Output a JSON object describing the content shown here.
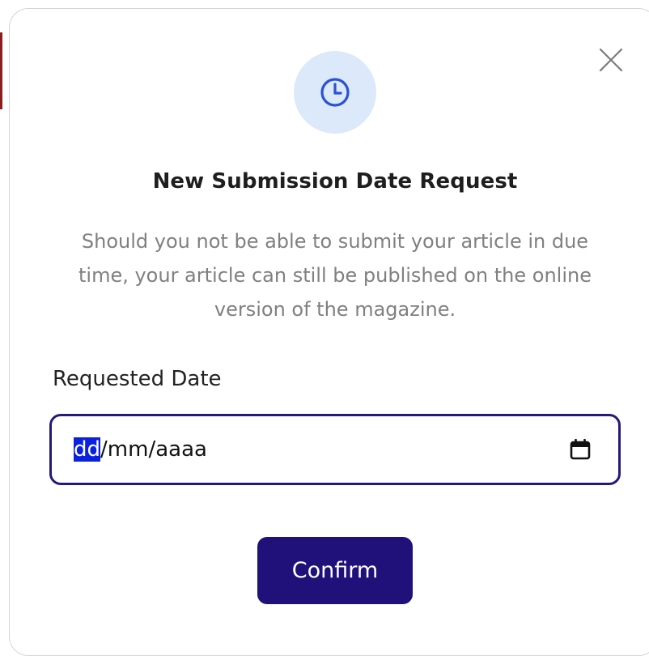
{
  "colors": {
    "accent": "#20107a",
    "icon_bg": "#dce9fb",
    "icon_fg": "#2a52d6",
    "input_border": "#241a7a",
    "selection": "#0a22e0"
  },
  "dialog": {
    "close_icon": "close-icon",
    "header_icon": "clock-icon",
    "title": "New Submission Date Request",
    "description": "Should you not be able to submit your article in due time, your article can still be published on the online version of the magazine."
  },
  "form": {
    "field_label": "Requested Date",
    "date_input": {
      "placeholder_day": "dd",
      "separator_1": "/",
      "placeholder_month": "mm",
      "separator_2": "/",
      "placeholder_year": "aaaa",
      "selected_segment": "day",
      "calendar_icon": "calendar-icon"
    },
    "confirm_label": "Confirm"
  }
}
